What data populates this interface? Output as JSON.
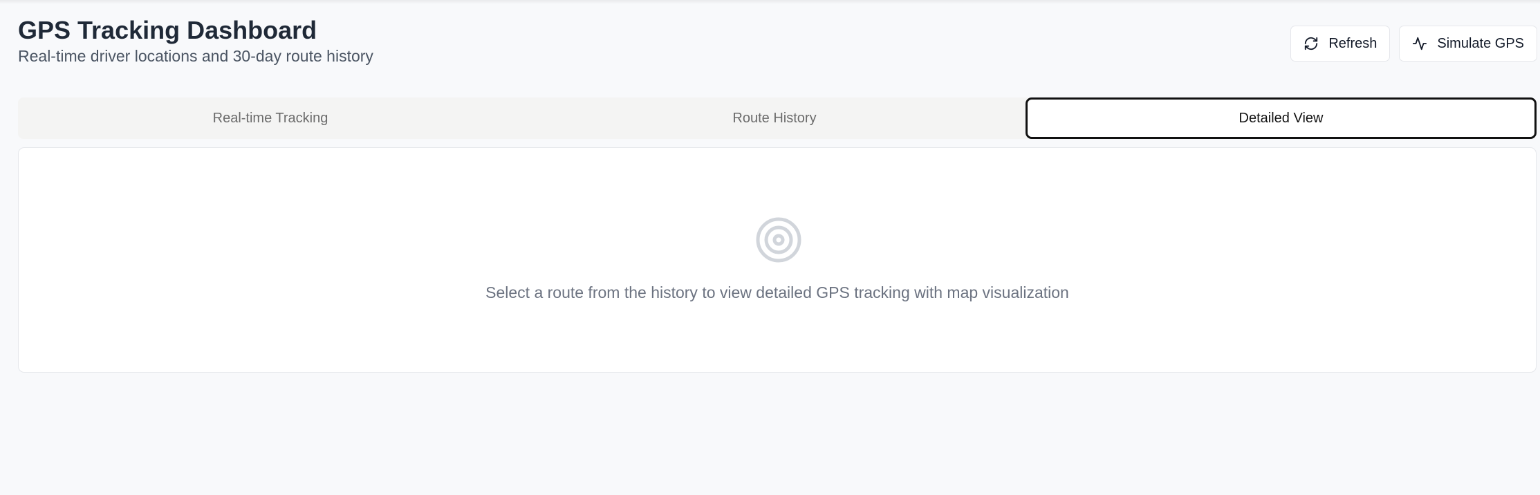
{
  "header": {
    "title": "GPS Tracking Dashboard",
    "subtitle": "Real-time driver locations and 30-day route history"
  },
  "actions": {
    "refresh_label": "Refresh",
    "refresh_icon": "refresh-icon",
    "simulate_label": "Simulate GPS",
    "simulate_icon": "activity-icon"
  },
  "tabs": [
    {
      "label": "Real-time Tracking",
      "active": false
    },
    {
      "label": "Route History",
      "active": false
    },
    {
      "label": "Detailed View",
      "active": true
    }
  ],
  "detail_panel": {
    "empty_icon": "target-icon",
    "empty_message": "Select a route from the history to view detailed GPS tracking with map visualization"
  },
  "colors": {
    "background": "#f8f9fb",
    "title": "#1f2937",
    "muted_text": "#6b7280",
    "active_tab_border": "#111111",
    "icon_gray": "#d1d5db"
  }
}
